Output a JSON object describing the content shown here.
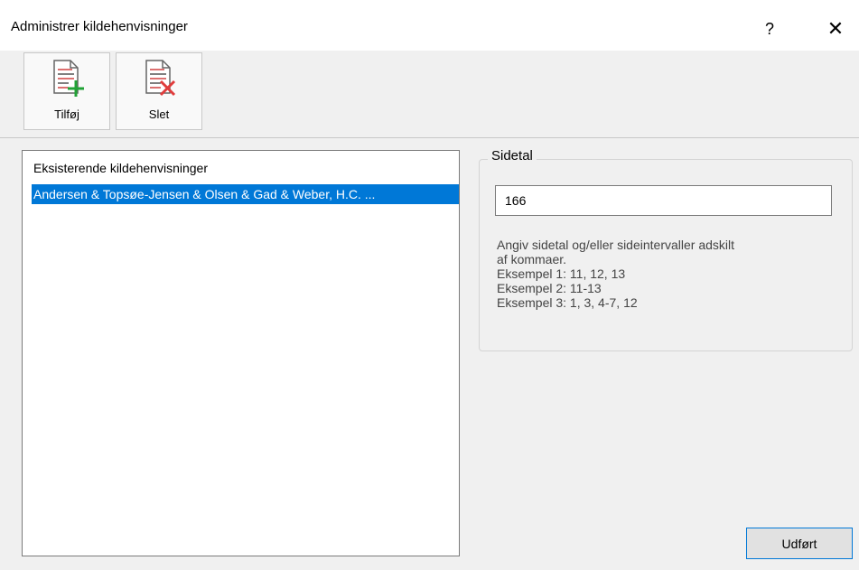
{
  "window": {
    "title": "Administrer kildehenvisninger",
    "help_label": "?",
    "close_label": "✕"
  },
  "toolbar": {
    "add_label": "Tilføj",
    "delete_label": "Slet"
  },
  "list": {
    "header": "Eksisterende kildehenvisninger",
    "items": [
      {
        "label": "Andersen & Topsøe-Jensen & Olsen & Gad & Weber, H.C. ...",
        "selected": true
      }
    ]
  },
  "pages": {
    "legend": "Sidetal",
    "value": "166",
    "help_lines": [
      "Angiv sidetal og/eller sideintervaller adskilt",
      "af kommaer.",
      "Eksempel 1: 11, 12, 13",
      "Eksempel 2: 11-13",
      "Eksempel 3: 1, 3, 4-7, 12"
    ]
  },
  "done_label": "Udført",
  "colors": {
    "selection": "#0078d7",
    "add_icon": "#21a336",
    "delete_icon": "#e03c3c",
    "doc_lines": "#d04040"
  },
  "icons": {
    "add": "document-add-icon",
    "delete": "document-delete-icon"
  }
}
